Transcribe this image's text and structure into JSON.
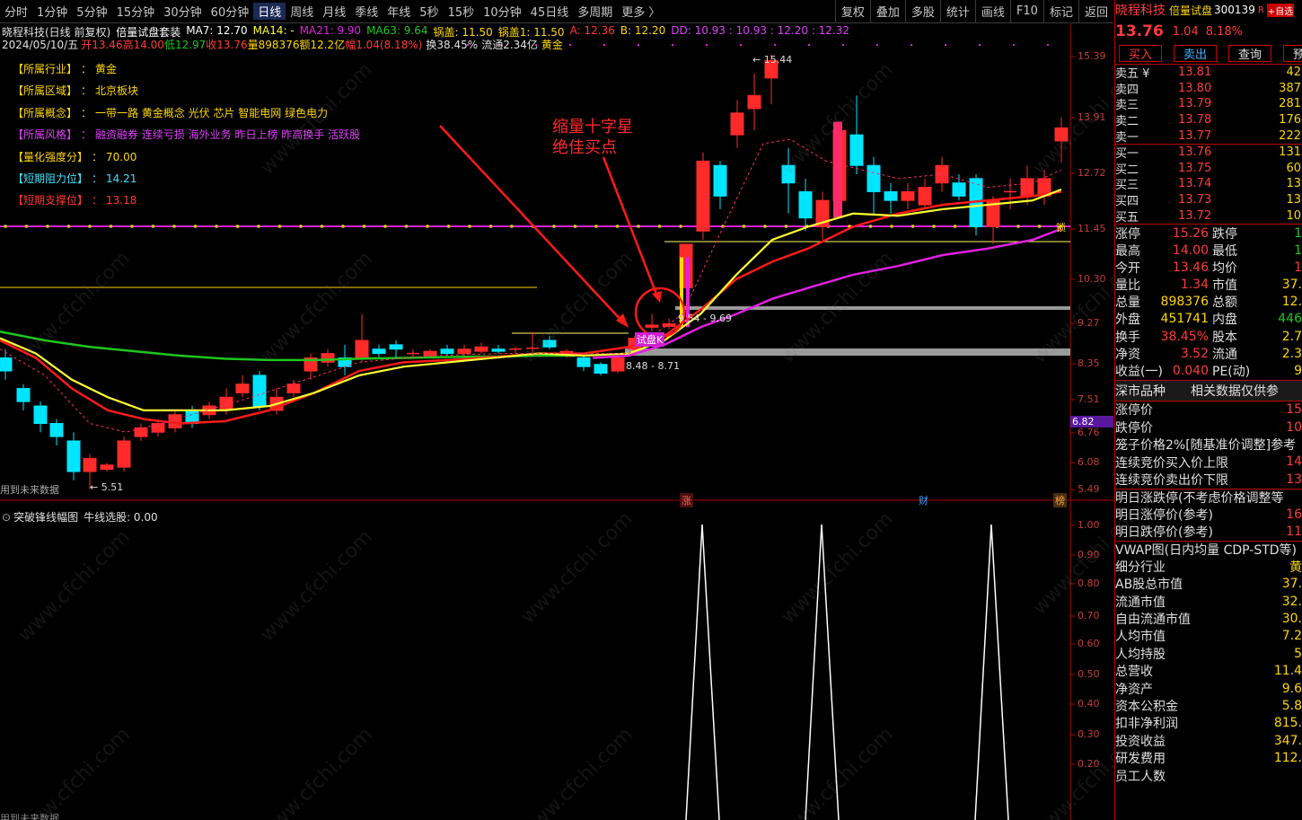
{
  "toolbar": {
    "periods": [
      "分时",
      "1分钟",
      "5分钟",
      "15分钟",
      "30分钟",
      "60分钟",
      "日线",
      "周线",
      "月线",
      "季线",
      "年线",
      "5秒",
      "15秒",
      "10分钟",
      "45日线",
      "多周期",
      "更多 〉"
    ],
    "active_period": "日线",
    "tools": [
      "复权",
      "叠加",
      "多股",
      "统计",
      "画线",
      "F10",
      "标记",
      "返回"
    ]
  },
  "info": {
    "title": "晓程科技(日线 前复权)",
    "formula": "倍量试盘套装",
    "ma7": "MA7: 12.70",
    "ma14": "MA14: -",
    "ma21": "MA21: 9.90",
    "ma63": "MA63: 9.64",
    "guogai": "锅盖: 11.50",
    "guogai1": "锅盖1: 11.50",
    "a": "A: 12.36",
    "b": "B: 12.20",
    "dd": "DD: 10.93 : 10.93 : 12.20 : 12.32",
    "date": "2024/05/10/五",
    "open": "开13.46",
    "high": "高14.00",
    "low": "低12.97",
    "close": "收13.76",
    "vol": "量898376",
    "amt": "额12.2亿",
    "amp": "幅1.04(8.18%)",
    "turn": "换38.45%",
    "flow": "流通2.34亿",
    "sector": "黄金"
  },
  "stock_info": [
    {
      "k": "【所属行业】",
      "v": "黄金",
      "color": "#ffd800"
    },
    {
      "k": "【所属区域】",
      "v": "北京板块",
      "color": "#ffd800"
    },
    {
      "k": "【所属概念】",
      "v": "一带一路 黄金概念 光伏 芯片 智能电网 绿色电力",
      "color": "#ffd800"
    },
    {
      "k": "【所属风格】",
      "v": "融资融券 连续亏损 海外业务 昨日上榜 昨高换手 活跃股",
      "color": "#e040fb"
    },
    {
      "k": "【量化强度分】",
      "v": "70.00",
      "color": "#ffd800"
    },
    {
      "k": "【短期阻力位】",
      "v": "14.21",
      "color": "#40e0ff"
    },
    {
      "k": "【短期支撑位】",
      "v": "13.18",
      "color": "#ff3b3b"
    }
  ],
  "annotation": {
    "line1": "缩量十字星",
    "line2": "绝佳买点"
  },
  "tags": {
    "trial": "试盘K",
    "range_top": "9.54 - 9.69",
    "range_bot": "8.48 - 8.71",
    "max": "15.44",
    "min": "5.51",
    "future": "用到未来数据",
    "future2": "用到未来数据",
    "lock": "锁"
  },
  "events": {
    "zhang": "涨",
    "cai": "财",
    "bang": "榜"
  },
  "main_axis": [
    "15.39",
    "13.91",
    "12.72",
    "11.45",
    "10.30",
    "9.27",
    "8.35",
    "7.51",
    "6.76",
    "6.08",
    "5.49"
  ],
  "price_marker": "6.82",
  "indicator": {
    "title": "突破锋线幅图",
    "sub": "牛线选股: 0.00",
    "axis": [
      "1.00",
      "0.90",
      "0.80",
      "0.70",
      "0.60",
      "0.50",
      "0.40",
      "0.30",
      "0.20"
    ]
  },
  "right": {
    "name": "晓程科技",
    "formula": "倍量试盘",
    "code": "300139",
    "flag": "R",
    "fav": "+自选",
    "price": "13.76",
    "change": "1.04",
    "pct": "8.18%",
    "buttons": [
      "买入",
      "卖出",
      "查询",
      "预警"
    ],
    "asks": [
      {
        "l": "卖五 ¥",
        "p": "13.81",
        "v": "42"
      },
      {
        "l": "卖四",
        "p": "13.80",
        "v": "387"
      },
      {
        "l": "卖三",
        "p": "13.79",
        "v": "281"
      },
      {
        "l": "卖二",
        "p": "13.78",
        "v": "176"
      },
      {
        "l": "卖一",
        "p": "13.77",
        "v": "222"
      }
    ],
    "bids": [
      {
        "l": "买一",
        "p": "13.76",
        "v": "131"
      },
      {
        "l": "买二",
        "p": "13.75",
        "v": "60"
      },
      {
        "l": "买三",
        "p": "13.74",
        "v": "13"
      },
      {
        "l": "买四",
        "p": "13.73",
        "v": "13"
      },
      {
        "l": "买五",
        "p": "13.72",
        "v": "10"
      }
    ],
    "stats": [
      {
        "k1": "涨停",
        "v1": "15.26",
        "k2": "跌停",
        "v2": "1"
      },
      {
        "k1": "最高",
        "v1": "14.00",
        "k2": "最低",
        "v2": "1"
      },
      {
        "k1": "今开",
        "v1": "13.46",
        "k2": "均价",
        "v2": "1"
      },
      {
        "k1": "量比",
        "v1": "1.34",
        "k2": "市值",
        "v2": "37."
      },
      {
        "k1": "总量",
        "v1": "898376",
        "k2": "总额",
        "v2": "12."
      },
      {
        "k1": "外盘",
        "v1": "451741",
        "k2": "内盘",
        "v2": "446"
      },
      {
        "k1": "换手",
        "v1": "38.45%",
        "k2": "股本",
        "v2": "2.7"
      },
      {
        "k1": "净资",
        "v1": "3.52",
        "k2": "流通",
        "v2": "2.3"
      },
      {
        "k1": "收益(一)",
        "v1": "0.040",
        "k2": "PE(动)",
        "v2": "9"
      }
    ],
    "section1": "深市品种",
    "section1b": "相关数据仅供参",
    "rows2": [
      {
        "k": "涨停价",
        "v": "15"
      },
      {
        "k": "跌停价",
        "v": "10"
      },
      {
        "k": "笼子价格2%[随基准价调整]参考",
        "v": ""
      },
      {
        "k": "连续竞价买入价上限",
        "v": "14"
      },
      {
        "k": "连续竞价卖出价下限",
        "v": "13"
      },
      {
        "k": "明日涨跌停(不考虑价格调整等",
        "v": ""
      },
      {
        "k": "明日涨停价(参考)",
        "v": "16"
      },
      {
        "k": "明日跌停价(参考)",
        "v": "11"
      },
      {
        "k": "VWAP图(日内均量 CDP-STD等)",
        "v": ""
      },
      {
        "k": "细分行业",
        "v": "黄"
      },
      {
        "k": "AB股总市值",
        "v": "37."
      },
      {
        "k": "流通市值",
        "v": "32."
      },
      {
        "k": "自由流通市值",
        "v": "30."
      },
      {
        "k": "人均市值",
        "v": "7.2"
      },
      {
        "k": "人均持股",
        "v": "5"
      },
      {
        "k": "总营收",
        "v": "11.4"
      },
      {
        "k": "净资产",
        "v": "9.6"
      },
      {
        "k": "资本公积金",
        "v": "5.8"
      },
      {
        "k": "扣非净利润",
        "v": "815."
      },
      {
        "k": "投资收益",
        "v": "347."
      },
      {
        "k": "研发费用",
        "v": "112."
      },
      {
        "k": "员工人数",
        "v": ""
      }
    ]
  },
  "watermark": "www.cfchi.com",
  "colors": {
    "up": "#ff2a2a",
    "down": "#00e5ff",
    "ma_yellow": "#ffff33",
    "ma_red": "#e01010",
    "ma_green": "#1ec71e",
    "ma_magenta": "#e020e0",
    "accent": "#ff3b3b",
    "grid": "#b00000"
  }
}
